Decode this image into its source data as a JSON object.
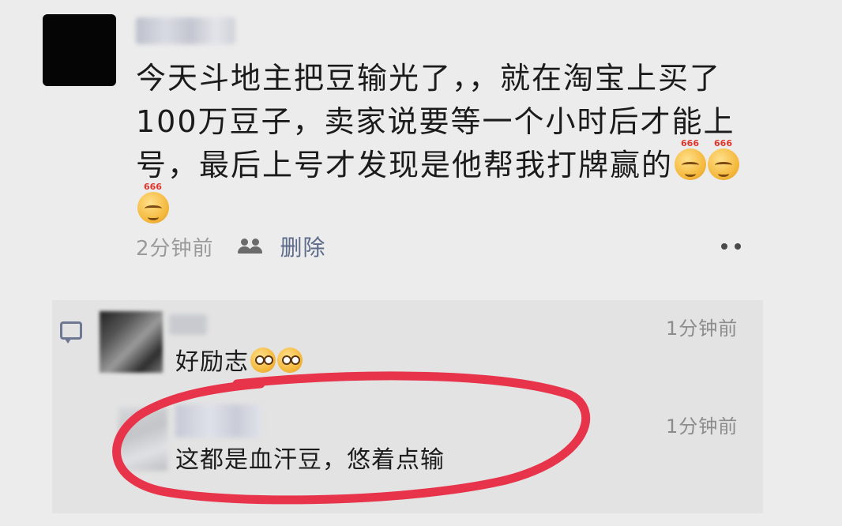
{
  "post": {
    "text": "今天斗地主把豆输光了，，就在淘宝上买了100万豆子，卖家说要等一个小时后才能上号，最后上号才发现是他帮我打牌赢的",
    "emoji_label": "666",
    "emoji_name": "smirk-666-emoji",
    "time": "2分钟前",
    "delete_label": "删除"
  },
  "comments": [
    {
      "text": "好励志",
      "time": "1分钟前",
      "emoji_name": "shy-emoji"
    },
    {
      "text": "这都是血汗豆，悠着点输",
      "time": "1分钟前"
    }
  ],
  "colors": {
    "background": "#ececec",
    "link": "#5c6b8a",
    "highlight_circle": "#e8344a"
  }
}
